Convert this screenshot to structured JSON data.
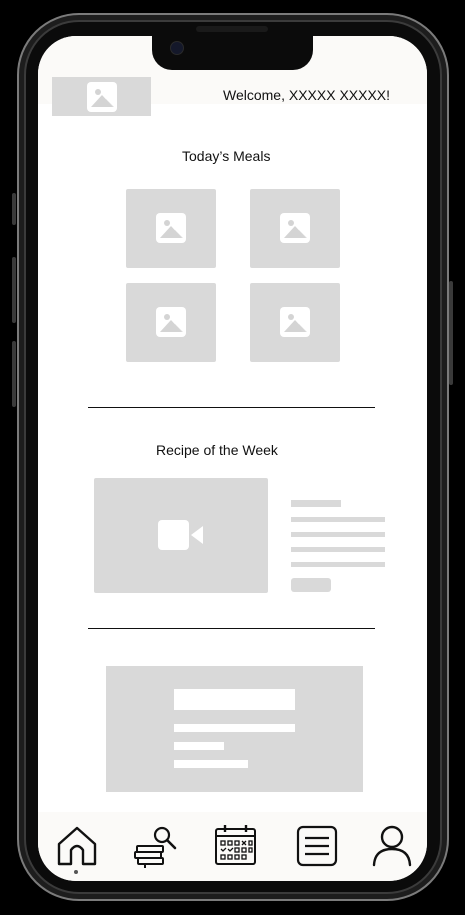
{
  "header": {
    "welcome_text": "Welcome, XXXXX XXXXX!",
    "logo_icon": "image-placeholder-icon"
  },
  "todays_meals": {
    "title": "Today’s Meals",
    "items": [
      {
        "icon": "image-placeholder-icon"
      },
      {
        "icon": "image-placeholder-icon"
      },
      {
        "icon": "image-placeholder-icon"
      },
      {
        "icon": "image-placeholder-icon"
      }
    ]
  },
  "recipe_of_week": {
    "title": "Recipe of the Week",
    "media_icon": "video-camera-icon"
  },
  "nav": {
    "items": [
      {
        "icon": "home-icon",
        "active": true
      },
      {
        "icon": "recipe-search-icon",
        "active": false
      },
      {
        "icon": "calendar-icon",
        "active": false
      },
      {
        "icon": "menu-list-icon",
        "active": false
      },
      {
        "icon": "profile-icon",
        "active": false
      }
    ]
  },
  "colors": {
    "placeholder": "#d9d9d9",
    "screen_bg": "#ffffff",
    "bar_bg": "#fbfaf8",
    "text": "#111111"
  }
}
